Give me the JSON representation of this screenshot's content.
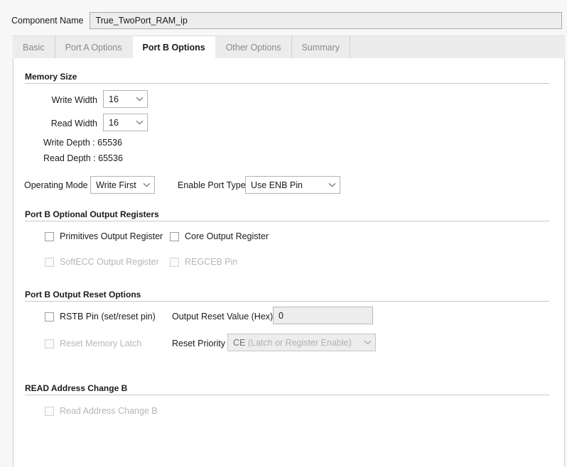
{
  "component": {
    "label": "Component Name",
    "value": "True_TwoPort_RAM_ip"
  },
  "tabs": [
    {
      "label": "Basic",
      "active": false
    },
    {
      "label": "Port A Options",
      "active": false
    },
    {
      "label": "Port B Options",
      "active": true
    },
    {
      "label": "Other Options",
      "active": false
    },
    {
      "label": "Summary",
      "active": false
    }
  ],
  "memory_size": {
    "title": "Memory Size",
    "write_width_label": "Write Width",
    "write_width_value": "16",
    "read_width_label": "Read Width",
    "read_width_value": "16",
    "write_depth_text": "Write Depth : 65536",
    "read_depth_text": "Read Depth : 65536",
    "operating_mode_label": "Operating Mode",
    "operating_mode_value": "Write First",
    "enable_port_type_label": "Enable Port Type",
    "enable_port_type_value": "Use ENB Pin"
  },
  "optional_output_registers": {
    "title": "Port B Optional Output Registers",
    "primitives_output_register": "Primitives Output Register",
    "core_output_register": "Core Output Register",
    "softecc_output_register": "SoftECC Output Register",
    "regceb_pin": "REGCEB Pin"
  },
  "output_reset_options": {
    "title": "Port B Output Reset Options",
    "rstb_pin": "RSTB Pin (set/reset pin)",
    "reset_memory_latch": "Reset Memory Latch",
    "output_reset_value_label": "Output Reset Value (Hex)",
    "output_reset_value": "0",
    "reset_priority_label": "Reset Priority",
    "reset_priority_value": "CE",
    "reset_priority_value_muted": "(Latch or Register Enable)"
  },
  "read_address_change": {
    "title": "READ Address Change B",
    "checkbox_label": "Read Address Change B"
  },
  "colors": {
    "panel_bg": "#ffffff",
    "tab_bg": "#ececec",
    "border": "#cfcfcf",
    "disabled_text": "#b6b6b6",
    "field_bg": "#ededed"
  }
}
